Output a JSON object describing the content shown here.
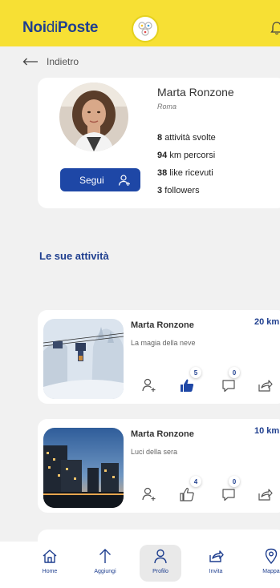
{
  "app": {
    "logo_bold_1": "Noi",
    "logo_light": "di",
    "logo_bold_2": "Poste"
  },
  "nav_back": {
    "label": "Indietro"
  },
  "profile": {
    "name": "Marta Ronzone",
    "city": "Roma",
    "follow_label": "Segui",
    "stats": [
      {
        "value": "8",
        "label": "attività svolte"
      },
      {
        "value": "94",
        "label": "km percorsi"
      },
      {
        "value": "38",
        "label": "like ricevuti"
      },
      {
        "value": "3",
        "label": "followers"
      }
    ]
  },
  "section": {
    "title": "Le sue attività"
  },
  "activities": [
    {
      "author": "Marta Ronzone",
      "title": "La magia della neve",
      "km": "20 km",
      "likes": "5",
      "comments": "0",
      "liked": true
    },
    {
      "author": "Marta Ronzone",
      "title": "Luci della sera",
      "km": "10 km",
      "likes": "4",
      "comments": "0",
      "liked": false
    }
  ],
  "bottom_nav": [
    {
      "label": "Home",
      "icon": "home-icon"
    },
    {
      "label": "Aggiungi",
      "icon": "arrow-up-icon"
    },
    {
      "label": "Profilo",
      "icon": "person-icon",
      "active": true
    },
    {
      "label": "Invita",
      "icon": "share-icon"
    },
    {
      "label": "Mappa",
      "icon": "map-pin-icon"
    }
  ],
  "colors": {
    "brand_yellow": "#f7e034",
    "brand_blue": "#1f3f8f",
    "button_blue": "#1e47a6",
    "background": "#f1f1f1"
  }
}
